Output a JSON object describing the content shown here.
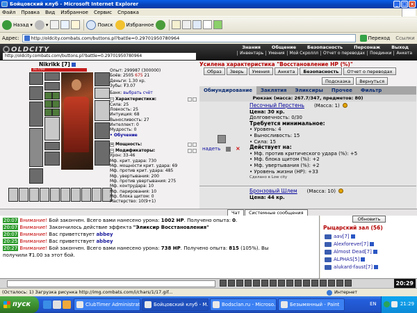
{
  "window": {
    "title": "Бойцовский клуб - Microsoft Internet Explorer",
    "btn_min": "_",
    "btn_max": "□",
    "btn_close": "×"
  },
  "menu": [
    "Файл",
    "Правка",
    "Вид",
    "Избранное",
    "Сервис",
    "Справка"
  ],
  "toolbar": {
    "back": "Назад",
    "search": "Поиск",
    "favorites": "Избранное"
  },
  "address": {
    "label": "Адрес:",
    "url": "http://oldcity.combats.com/buttons.pl?battle=0.29701950780964",
    "go": "Переход",
    "links": "Ссылки"
  },
  "game_header": {
    "logo": "OLDCITY",
    "inner_url": "http://oldcity.combats.com/buttons.pl?battle=0.29701950780964",
    "top_menu": [
      "Знания",
      "Общение",
      "Безопасность",
      "Персонаж",
      "Выход"
    ],
    "sub_menu": [
      "Инвентарь",
      "Умения",
      "Мой Скроллл",
      "Отчет о переводах",
      "Поединки",
      "Анкета"
    ]
  },
  "character": {
    "name": "Nikrikk",
    "level": "[7]",
    "hp_text": "317/50",
    "hp_fraction": 1.0,
    "experience": "Опыт: 299987 (300000)",
    "battles": "Боёв: 2505",
    "battles_win": "675",
    "battles_loss": "21",
    "money": "Деньги: 1.30 кр.",
    "zub": "Зубы: ₮3.07",
    "bank_label": "Банк:",
    "bank_link": "выбрать счёт",
    "characteristics_header": "Характеристики:",
    "characteristics": [
      "Сила: 25",
      "Ловкость: 25",
      "Интуиция: 68",
      "Выносливость: 27",
      "Интеллект: 0",
      "Мудрость: 0"
    ],
    "training_link": "• Обучение",
    "power_header": "Мощность:",
    "modifiers_header": "Модификаторы:",
    "modifiers": [
      "Урон: 33-46",
      "Мф. крит. удара: 730",
      "Мф. мощности крит. удара: 69",
      "Мф. против крит. удара: 485",
      "Мф. увертывания: 200",
      "Мф. против увертывания: 275",
      "Мф. контрудара: 10",
      "Мф. парирования: 10",
      "Мф. блока щитом: 0",
      "Мастерство: 10(9+1)"
    ]
  },
  "shop": {
    "title": "Усилена характеристика \"Восстановление HP (%)\"",
    "buttons_row1": [
      "Образ",
      "Зверь",
      "Умения",
      "Анкета",
      "Безопасность",
      "Отчет о переводах"
    ],
    "buttons_row2": [
      "Подсказка",
      "Вернуться"
    ],
    "tabs": [
      "Обмундирование",
      "Заклятия",
      "Эликсиры",
      "Прочее",
      "Фильтр"
    ],
    "active_tab": 0,
    "backpack": "Рюкзак (масса: 267.7/347, предметов: 80)",
    "wear_label": "надеть",
    "delete_label": "×",
    "item1": {
      "name": "Песочный Перстень",
      "mass": "(Масса: 1)",
      "price": "Цена: 30 кр.",
      "durability": "Долговечность: 0/30",
      "req_header": "Требуется минимальное:",
      "requirements": [
        "Уровень: 4",
        "Выносливость: 15",
        "Сила: 15"
      ],
      "acts_header": "Действует на:",
      "effects": [
        "Мф. против критического удара (%): +5",
        "Мф. блока щитом (%): +2",
        "Мф. увертывания (%): +2",
        "Уровень жизни (HP): +33"
      ],
      "made": "Сделано в Low city"
    },
    "item2": {
      "name": "Бронзовый Шлем",
      "mass": "(Масса: 10)",
      "price": "Цена: 44 кр."
    }
  },
  "chat": {
    "tab_chat": "Чат",
    "tab_system": "Системные сообщения",
    "messages": [
      {
        "time": "20:07",
        "warn": "Внимание!",
        "text": " Бой закончен. Всего вами нанесено урона: ",
        "b1": "1002 HP",
        "text2": ". Получено опыта: ",
        "b2": "0",
        "text3": "."
      },
      {
        "time": "20:07",
        "warn": "Внимание!",
        "text": " Закончилось действие эффекта ",
        "b1": "\"Эликсир Восстановления\"",
        "text2": "",
        "b2": "",
        "text3": ""
      },
      {
        "time": "20:07",
        "warn": "Внимание!",
        "text": " Вас приветствует ",
        "nick": "abbey"
      },
      {
        "time": "20:25",
        "warn": "Внимание!",
        "text": " Вас приветствует ",
        "nick": "abbey"
      },
      {
        "time": "20:27",
        "warn": "Внимание!",
        "text": " Бой закончен. Всего вами нанесено урона: ",
        "b1": "738 HP",
        "text2": ". Получено опыта: ",
        "b2": "815",
        "text3": " (105%). Вы"
      }
    ],
    "wrap_line": "получили ₮1.00 за этот бой."
  },
  "room": {
    "refresh": "Обновить",
    "title": "Рыцарский зал (56)",
    "users": [
      {
        "name": "aav[7]"
      },
      {
        "name": "Alexforever[7]"
      },
      {
        "name": "Almost Dead[7]"
      },
      {
        "name": "ALPHAS[5]"
      },
      {
        "name": "alukard-faust[7]"
      }
    ]
  },
  "game_clock": "20:29",
  "statusbar": {
    "text": "(Осталось: 1) Загрузка рисунка http://img.combats.com/i/chars/1/17.gif...",
    "zone": "Интернет"
  },
  "taskbar": {
    "start": "пуск",
    "tasks": [
      "ClubTimer Administrat...",
      "Бойцовский клуб - M...",
      "Bodsclan.ru - Microso...",
      "Безымянный - Paint"
    ],
    "active_task": 1,
    "lang": "EN",
    "clock": "21:29"
  },
  "colors": {
    "titlebar": "#0842b8",
    "game_red": "#b40000",
    "link_blue": "#00009c",
    "chat_time_green": "#2f9c2f",
    "start_green": "#3c8c2c"
  }
}
